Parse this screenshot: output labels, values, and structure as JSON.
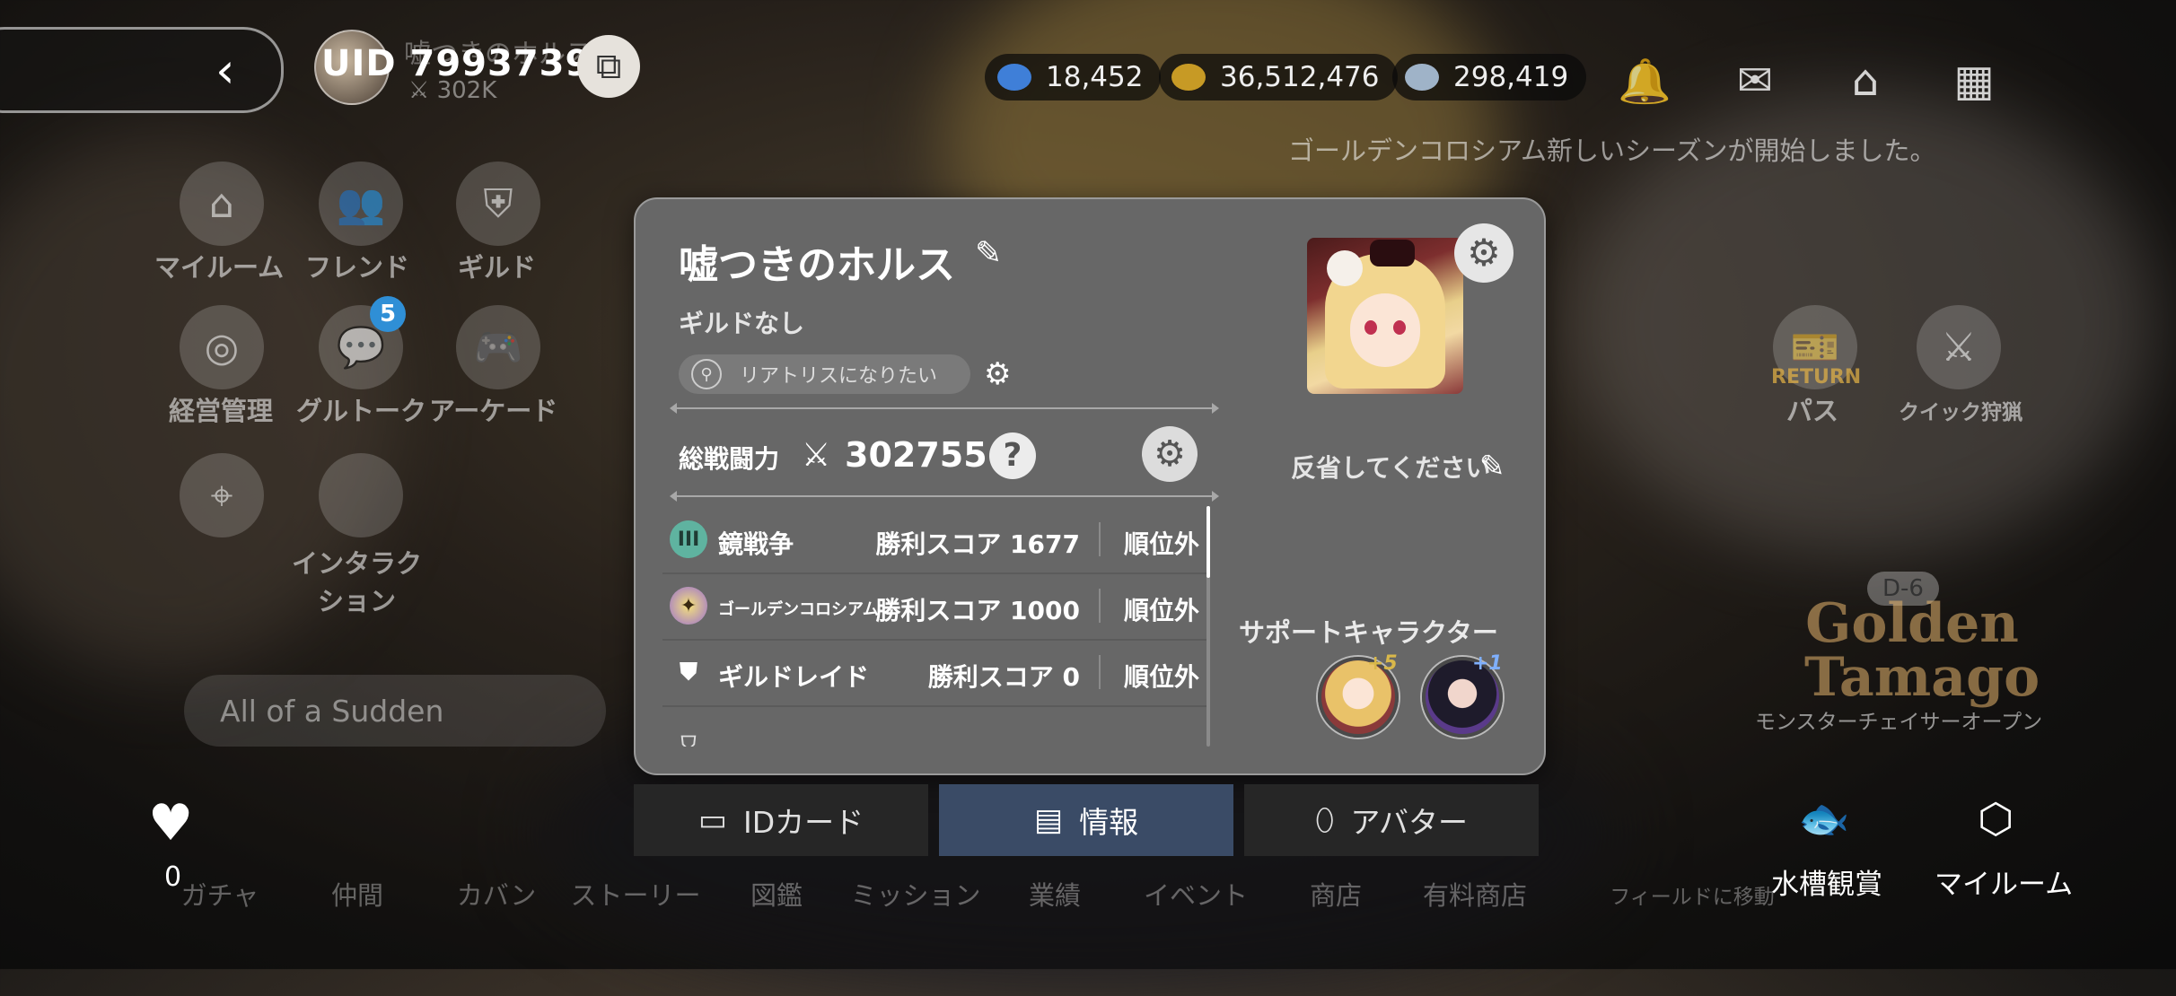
{
  "top": {
    "uid": "UID 7993739",
    "bg_name": "嘘つきのホルス",
    "bg_power": "302K",
    "currencies": [
      {
        "value": "18,452",
        "icon": "gem-icon",
        "color": "#3f7fd8"
      },
      {
        "value": "36,512,476",
        "icon": "gold-coin-icon",
        "color": "#c79a25"
      },
      {
        "value": "298,419",
        "icon": "silver-coin-icon",
        "color": "#9fb3c8"
      }
    ],
    "notice": "ゴールデンコロシアム新しいシーズンが開始しました。"
  },
  "side_menu": {
    "items": [
      "マイルーム",
      "フレンド",
      "ギルド",
      "経営管理",
      "グルトーク",
      "アーケード",
      "インタラク\nション"
    ],
    "badge": "5",
    "music": "All of a Sudden"
  },
  "right_menu": {
    "return_label": "RETURN",
    "pass_label": "パス",
    "quick_label": "クイック狩猟",
    "event_d": "D-6",
    "event_title": "Golden Tamago",
    "event_label": "モンスターチェイサーオープン"
  },
  "bottom_nav": {
    "items": [
      "ガチャ",
      "仲間",
      "カバン",
      "ストーリー",
      "図鑑",
      "ミッション",
      "業績",
      "イベント",
      "商店",
      "有料商店",
      "フィールドに移動"
    ],
    "heart_count": "0",
    "aquarium": "水槽観賞",
    "myroom": "マイルーム"
  },
  "profile": {
    "name": "嘘つきのホルス",
    "guild": "ギルドなし",
    "title": "リアトリスになりたい",
    "power_label": "総戦闘力",
    "power_value": "302755",
    "comment": "反省してください",
    "support_title": "サポートキャラクター",
    "supports": [
      {
        "plus": "+5",
        "color": "#e0b64a"
      },
      {
        "plus": "+1",
        "color": "#5a3a8a"
      }
    ],
    "rankings": [
      {
        "name": "鏡戦争",
        "score": "勝利スコア 1677",
        "rank": "順位外",
        "icon": "mirror-war-icon",
        "badge": "III"
      },
      {
        "name": "ゴールデンコロシアム",
        "score": "勝利スコア 1000",
        "rank": "順位外",
        "icon": "colosseum-icon"
      },
      {
        "name": "ギルドレイド",
        "score": "勝利スコア 0",
        "rank": "順位外",
        "icon": "guild-raid-icon"
      }
    ]
  },
  "tabs": [
    {
      "label": "IDカード",
      "icon": "id-card-icon"
    },
    {
      "label": "情報",
      "icon": "info-icon",
      "active": true
    },
    {
      "label": "アバター",
      "icon": "avatar-mirror-icon"
    }
  ]
}
